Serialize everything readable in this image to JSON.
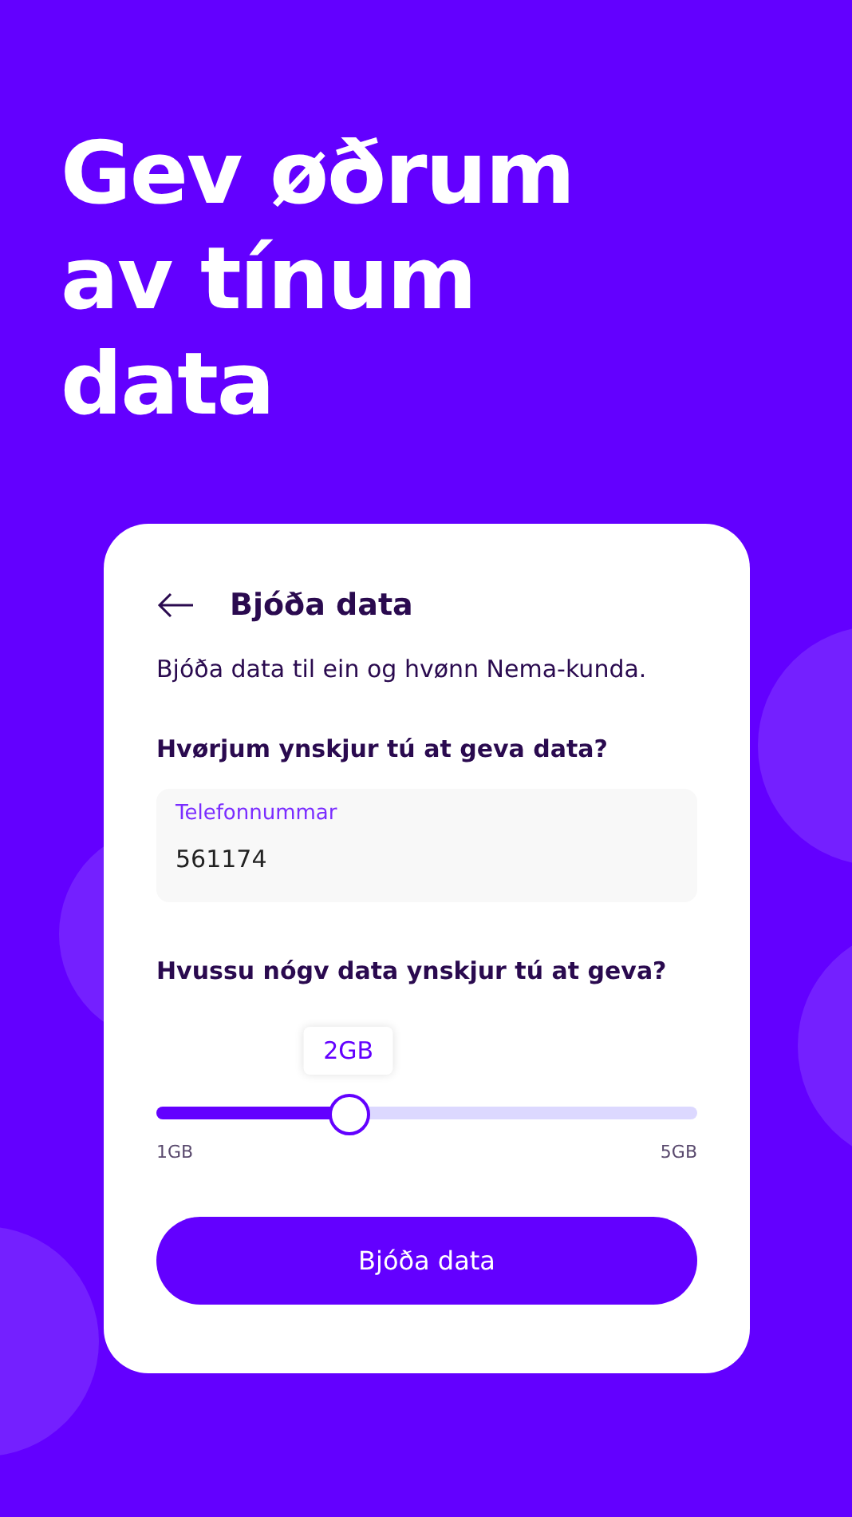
{
  "headline": [
    "Gev øðrum",
    "av tínum",
    "data"
  ],
  "card": {
    "title": "Bjóða data",
    "description": "Bjóða data til ein og hvønn Nema-kunda.",
    "recipient_question": "Hvørjum ynskjur tú at geva data?",
    "phone_field": {
      "label": "Telefonnummar",
      "value": "561174"
    },
    "amount_question": "Hvussu nógv data ynskjur tú at geva?",
    "slider": {
      "level": 0.355,
      "reading": "2GB",
      "min_label": "1GB",
      "max_label": "5GB"
    },
    "submit_button": "Bjóða data"
  }
}
